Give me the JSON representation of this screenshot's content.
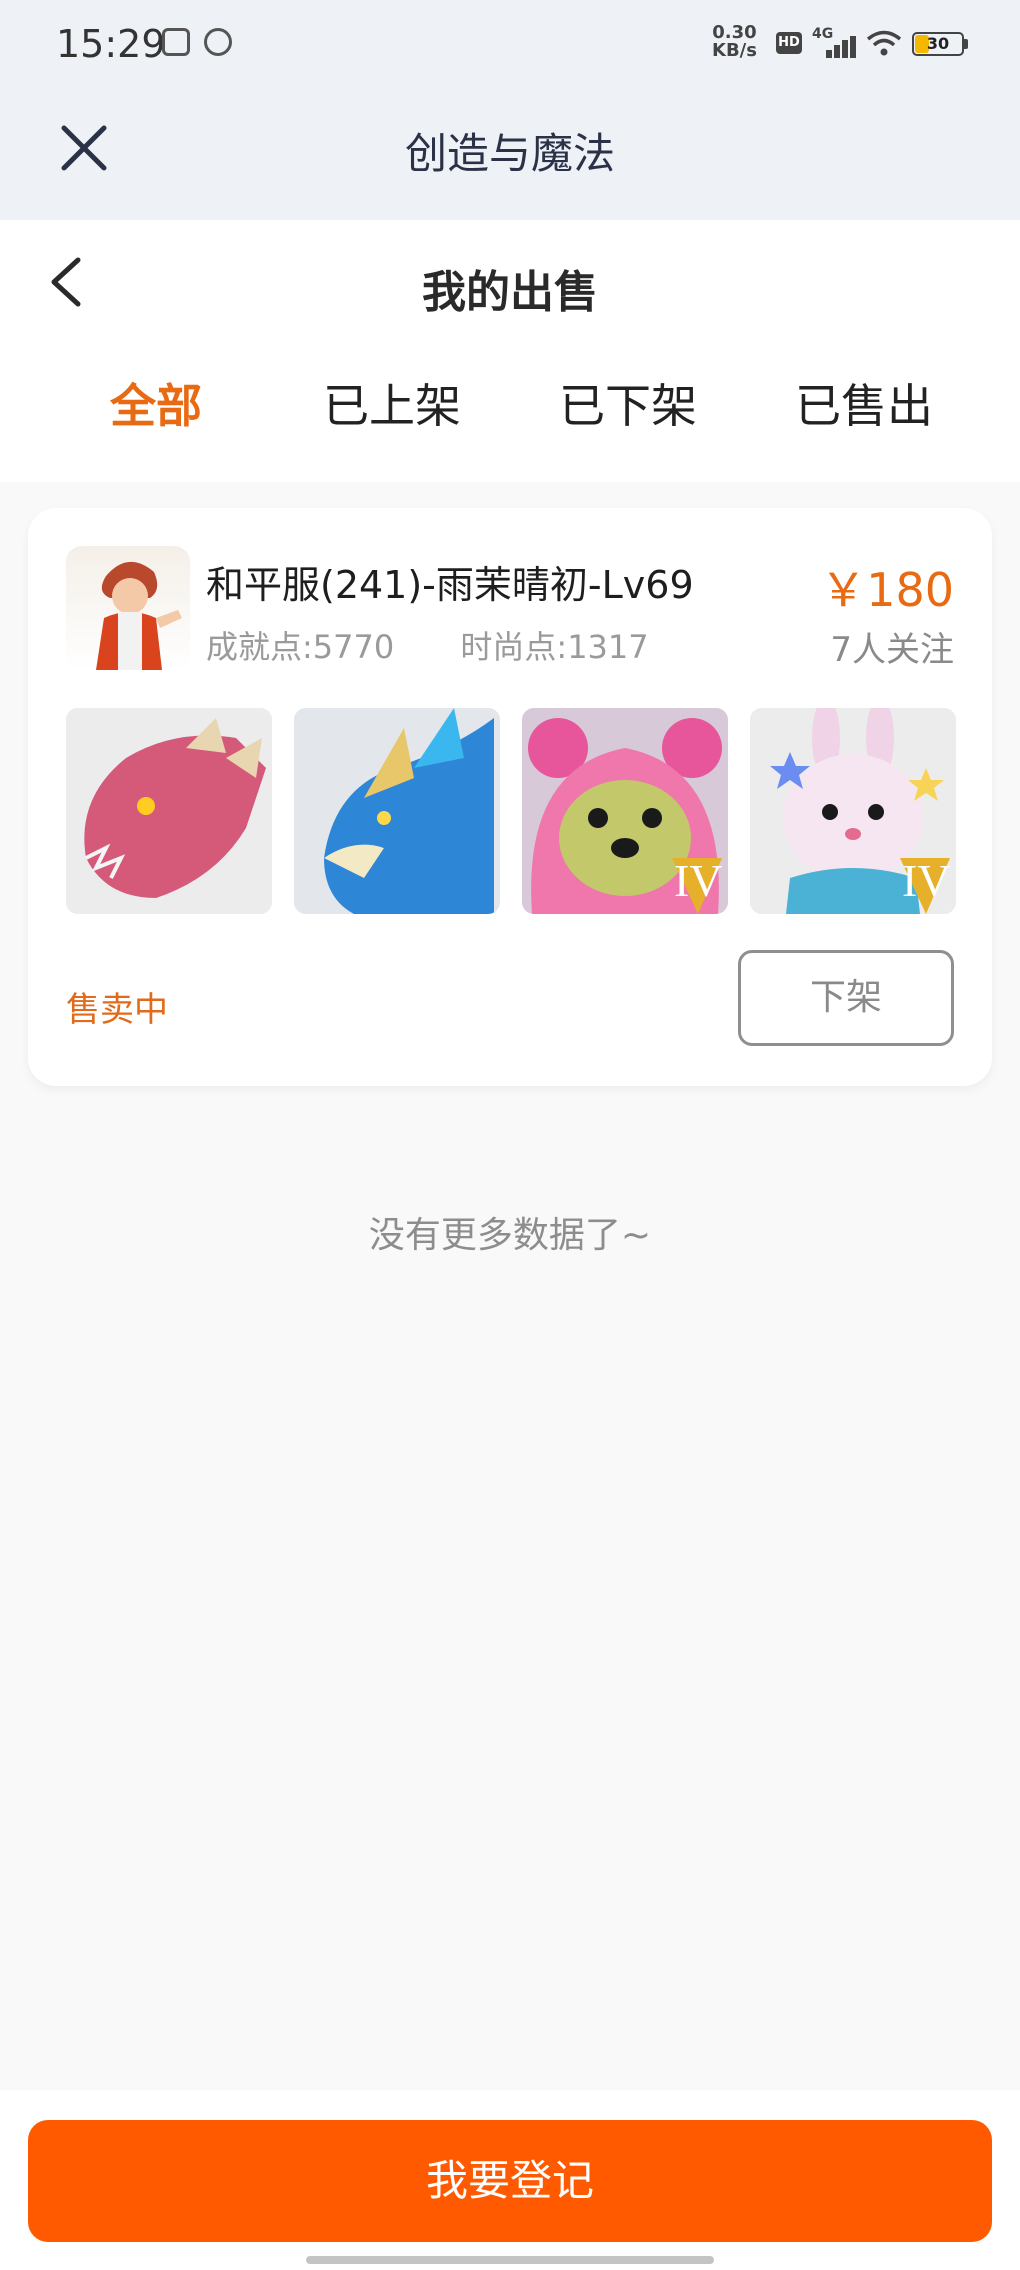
{
  "status_bar": {
    "time": "15:29",
    "net_speed_value": "0.30",
    "net_speed_unit": "KB/s",
    "hd": "HD",
    "network": "4G",
    "battery": "30"
  },
  "app_bar": {
    "title": "创造与魔法"
  },
  "page": {
    "title": "我的出售"
  },
  "tabs": [
    {
      "label": "全部"
    },
    {
      "label": "已上架"
    },
    {
      "label": "已下架"
    },
    {
      "label": "已售出"
    }
  ],
  "listing": {
    "title": "和平服(241)-雨茉晴初-Lv69",
    "achievement": "成就点:5770",
    "fashion": "时尚点:1317",
    "price": "￥180",
    "followers": "7人关注",
    "status": "售卖中",
    "delist_label": "下架",
    "thumbnails": [
      {
        "icon": "red-dragon-mount"
      },
      {
        "icon": "blue-dragon-mount"
      },
      {
        "icon": "pink-bear-pet",
        "badge": "IV"
      },
      {
        "icon": "pink-bunny-pet",
        "badge": "IV"
      }
    ]
  },
  "empty_message": "没有更多数据了~",
  "register_button": "我要登记",
  "colors": {
    "accent": "#e86a12",
    "button": "#ff5a00"
  }
}
